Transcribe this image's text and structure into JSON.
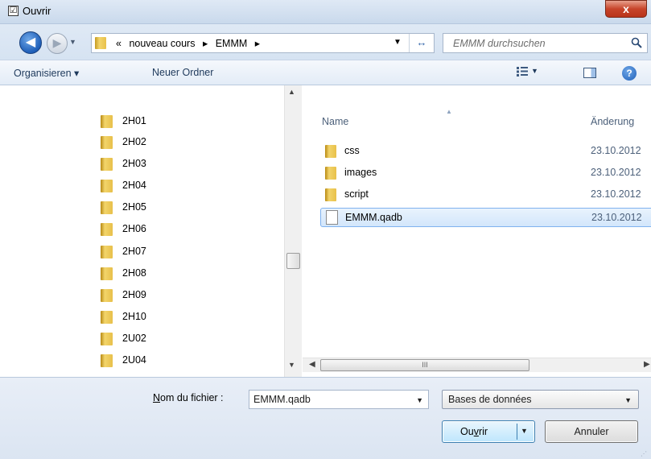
{
  "window": {
    "title": "Ouvrir",
    "checkbox_glyph": "☑",
    "close_glyph": "x"
  },
  "nav": {
    "back_glyph": "◀",
    "forward_glyph": "▶",
    "breadcrumb": [
      "«",
      "nouveau cours",
      "▸",
      "EMMM",
      "▸"
    ],
    "refresh_glyph": "↔",
    "search_placeholder": "EMMM durchsuchen"
  },
  "toolbar": {
    "organize_label": "Organisieren ▾",
    "new_folder_label": "Neuer Ordner",
    "help_glyph": "?"
  },
  "tree": {
    "items": [
      "2H01",
      "2H02",
      "2H03",
      "2H04",
      "2H05",
      "2H06",
      "2H07",
      "2H08",
      "2H09",
      "2H10",
      "2U02",
      "2U04"
    ]
  },
  "files": {
    "columns": {
      "name": "Name",
      "date": "Änderung"
    },
    "rows": [
      {
        "name": "css",
        "date": "23.10.2012",
        "type": "folder",
        "selected": false
      },
      {
        "name": "images",
        "date": "23.10.2012",
        "type": "folder",
        "selected": false
      },
      {
        "name": "script",
        "date": "23.10.2012",
        "type": "folder",
        "selected": false
      },
      {
        "name": "EMMM.qadb",
        "date": "23.10.2012",
        "type": "file",
        "selected": true
      }
    ],
    "hscroll_label": "III"
  },
  "footer": {
    "filename_label_prefix": "N",
    "filename_label_rest": "om du fichier :",
    "filename_value": "EMMM.qadb",
    "file_type": "Bases de données",
    "open_label_prefix": "Ou",
    "open_label_underline": "v",
    "open_label_rest": "rir",
    "cancel_label": "Annuler"
  },
  "colors": {
    "accent": "#3c7fb1",
    "selection": "#d3e6fb",
    "folder": "#e8c04a"
  }
}
